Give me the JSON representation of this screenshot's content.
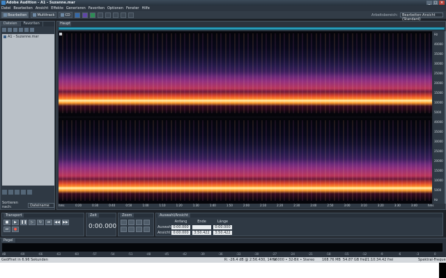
{
  "window": {
    "title": "Adobe Audition - A1 - Suzanne.mar"
  },
  "menu": [
    "Datei",
    "Bearbeiten",
    "Ansicht",
    "Effekte",
    "Generieren",
    "Favoriten",
    "Optionen",
    "Fenster",
    "Hilfe"
  ],
  "toolbar": {
    "edit_label": "Bearbeiten",
    "multitrack_label": "Multitrack",
    "cd_label": "CD",
    "workspace_label": "Arbeitsbereich:",
    "workspace_value": "Bearbeiten-Ansicht (Standard)"
  },
  "files_panel": {
    "tabs": [
      "Dateien",
      "Favoriten"
    ],
    "items": [
      {
        "name": "A1 - Suzanne.mar"
      }
    ],
    "sort_label": "Sortieren nach:",
    "sort_value": "Dateiname"
  },
  "main": {
    "tab_label": "Haupt",
    "time_ruler": [
      "hms",
      "0:20",
      "0:30",
      "0:40",
      "0:50",
      "1:00",
      "1:10",
      "1:20",
      "1:30",
      "1:40",
      "1:50",
      "2:00",
      "2:10",
      "2:20",
      "2:30",
      "2:40",
      "2:50",
      "3:00",
      "3:10",
      "3:20",
      "3:30",
      "3:40",
      "hms"
    ],
    "freq_ruler_top": [
      "Hz",
      "40000",
      "35000",
      "30000",
      "25000",
      "20000",
      "15000",
      "10000",
      "5000"
    ],
    "freq_ruler_bottom": [
      "40000",
      "35000",
      "30000",
      "25000",
      "20000",
      "15000",
      "10000",
      "5000",
      "Hz"
    ]
  },
  "transport": {
    "title": "Transport"
  },
  "time_panel": {
    "title": "Zeit",
    "value": "0:00.000"
  },
  "zoom_panel": {
    "title": "Zoom"
  },
  "selection_panel": {
    "title": "Auswahl/Ansicht",
    "headers": [
      "Anfang",
      "Ende",
      "Länge"
    ],
    "rows": [
      {
        "label": "Auswahl",
        "values": [
          "0:00.000",
          "",
          "0:00.000"
        ]
      },
      {
        "label": "Ansicht",
        "values": [
          "0:00.000",
          "3:50.422",
          "3:50.422"
        ]
      }
    ]
  },
  "levels_panel": {
    "title": "Pegel",
    "scale": [
      "dB",
      "-69",
      "-66",
      "-63",
      "-60",
      "-57",
      "-54",
      "-51",
      "-48",
      "-45",
      "-42",
      "-39",
      "-36",
      "-33",
      "-30",
      "-27",
      "-24",
      "-21",
      "-18",
      "-15",
      "-12",
      "-9",
      "-6",
      "-3",
      "0"
    ]
  },
  "status_bar": {
    "left": "Geöffnet in 6.96 Sekunden",
    "channel_info": "R: -26.4 dB @ 2:56.430, 14Hz",
    "format": "96000 • 32-Bit • Stereo",
    "size": "168.76 MB",
    "disk": "54.87 GB frei",
    "free_time": "21:10:34.42 frei",
    "view": "Spektral-Frequenz"
  },
  "colors": {
    "accent": "#2a9bb8",
    "background": "#1e2228"
  }
}
